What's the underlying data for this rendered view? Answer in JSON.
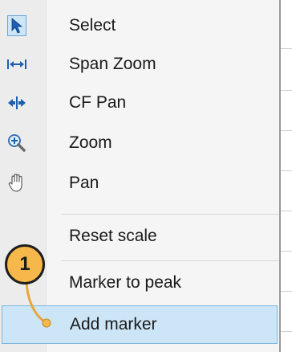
{
  "menu": {
    "items": [
      {
        "label": "Select",
        "icon": "pointer-arrow-icon",
        "selected": true
      },
      {
        "label": "Span Zoom",
        "icon": "span-zoom-icon"
      },
      {
        "label": "CF Pan",
        "icon": "cf-pan-icon"
      },
      {
        "label": "Zoom",
        "icon": "magnifier-plus-icon"
      },
      {
        "label": "Pan",
        "icon": "hand-icon"
      },
      {
        "label": "Reset scale"
      },
      {
        "label": "Marker to peak"
      },
      {
        "label": "Add marker",
        "highlighted": true
      }
    ]
  },
  "callout": {
    "number": "1",
    "color": "#f6b84a"
  },
  "colors": {
    "highlight": "#cde6f7",
    "highlight_border": "#7ab3dd",
    "icon_blue": "#1e5fb4"
  }
}
